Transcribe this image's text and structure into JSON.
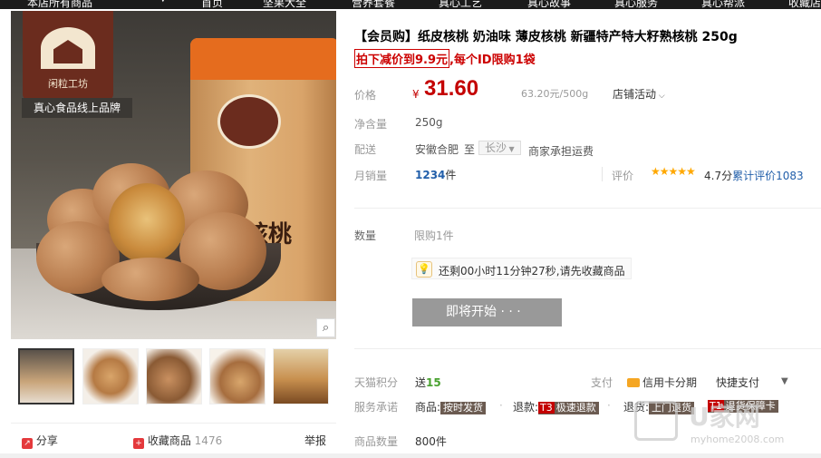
{
  "top_nav": {
    "items": [
      "本店所有商品",
      "首页",
      "坚果大全",
      "营养套餐",
      "真心工艺",
      "真心故事",
      "真心服务",
      "真心帮派",
      "收藏店"
    ]
  },
  "gallery": {
    "brand_cn": "闲粒工坊",
    "slogan": "真心食品线上品牌",
    "package_word": "核桃",
    "zoom_icon": "magnifier-icon",
    "thumbnails": [
      "thumb-1",
      "thumb-2",
      "thumb-3",
      "thumb-4",
      "thumb-5"
    ]
  },
  "share_row": {
    "share_label": "分享",
    "favorite_label": "收藏商品",
    "favorite_count": "1476",
    "report_label": "举报"
  },
  "product": {
    "title": "【会员购】纸皮核桃 奶油味 薄皮核桃 新疆特产特大籽熟核桃 250g",
    "promo_boxed": "拍下减价到9.9元",
    "promo_rest": ",每个ID限购1袋",
    "price_label": "价格",
    "currency": "¥",
    "price": "31.60",
    "unit_price": "63.20元/500g",
    "store_activity": "店铺活动",
    "net_label": "净含量",
    "net_value": "250g",
    "ship_label": "配送",
    "ship_from": "安徽合肥",
    "ship_to_word": "至",
    "ship_city": "长沙",
    "ship_fee": "商家承担运费",
    "sales_label": "月销量",
    "sales_value": "1234",
    "sales_unit": "件",
    "rating_label": "评价",
    "rating_score": "4.7分",
    "rating_count": "累计评价1083",
    "qty_label": "数量",
    "qty_limit": "限购1件",
    "tip_text": "还剩00小时11分钟27秒,请先收藏商品",
    "buy_button": "即将开始 · · ·",
    "points_label": "天猫积分",
    "points_prefix": "送",
    "points_value": "15",
    "pay_label": "支付",
    "pay_credit": "信用卡分期",
    "pay_quick": "快捷支付",
    "service_label": "服务承诺",
    "service_goods": "商品:",
    "service_goods_tag": "按时发货",
    "service_refund": "退款:",
    "service_refund_tag": "极速退款",
    "service_return": "退货:",
    "service_return_tag1": "上门退货",
    "service_return_tag2": "退货保障卡",
    "stock_label": "商品数量",
    "stock_value": "800件"
  },
  "watermark": {
    "text": "U家网",
    "url": "myhome2008.com"
  },
  "colors": {
    "price_red": "#c40000",
    "link_blue": "#225faa",
    "star_orange": "#ffa800",
    "disabled_button": "#999999"
  }
}
